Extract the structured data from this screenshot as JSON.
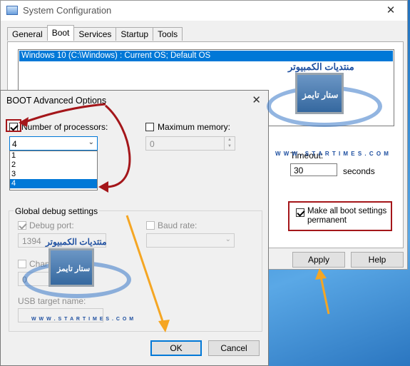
{
  "syscfg": {
    "title": "System Configuration",
    "close_glyph": "✕",
    "tabs": [
      "General",
      "Boot",
      "Services",
      "Startup",
      "Tools"
    ],
    "os_entry": "Windows 10 (C:\\Windows) : Current OS; Default OS",
    "timeout_label": "Timeout:",
    "timeout_value": "30",
    "seconds_label": "seconds",
    "make_permanent_label": "Make all boot settings permanent",
    "make_permanent_checked": true,
    "buttons": {
      "apply": "Apply",
      "help": "Help"
    }
  },
  "boot_adv": {
    "title": "BOOT Advanced Options",
    "close_glyph": "✕",
    "num_processors_label": "Number of processors:",
    "num_processors_checked": true,
    "num_processors_value": "4",
    "num_processors_options": [
      "1",
      "2",
      "3",
      "4"
    ],
    "max_memory_label": "Maximum memory:",
    "max_memory_value": "0",
    "global_debug_title": "Global debug settings",
    "debug_port_label": "Debug port:",
    "debug_port_value": "1394",
    "baud_rate_label": "Baud rate:",
    "channel_label": "Channel:",
    "channel_value": "0",
    "usb_target_label": "USB target name:",
    "ok_label": "OK",
    "cancel_label": "Cancel"
  },
  "watermark": {
    "arabic_line": "منتديات الكمبيوتر",
    "brand": "ستار تايمز",
    "url": "W W W . S T A R T I M E S . C O M"
  },
  "colors": {
    "accent": "#0078d7",
    "annotation_red": "#a4161a",
    "annotation_orange": "#f5a623"
  }
}
